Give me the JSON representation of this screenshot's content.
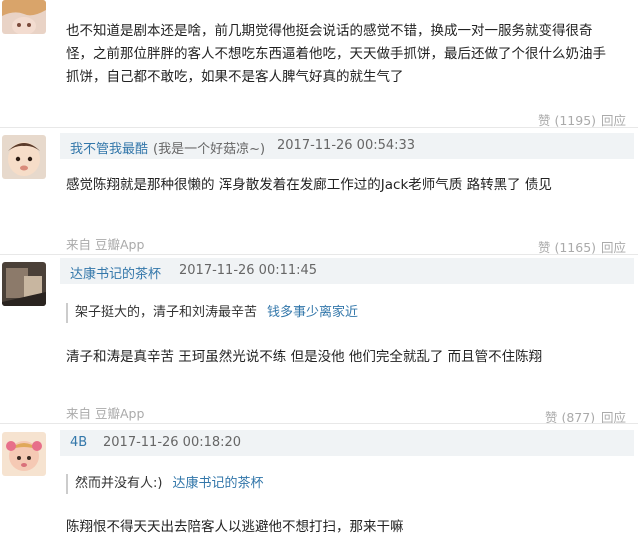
{
  "comment0": {
    "lines": [
      "也不知道是剧本还是啥，前几期觉得他挺会说话的感觉不错，换成一对一服务就变得很奇",
      "怪，之前那位胖胖的客人不想吃东西逼着他吃，天天做手抓饼，最后还做了个很什么奶油手",
      "抓饼，自己都不敢吃，如果不是客人脾气好真的就生气了"
    ],
    "vote": "赞 (1195)",
    "reply": "回应"
  },
  "comment1": {
    "username": "我不管我最酷",
    "note": "(我是一个好菇凉~)",
    "time": "2017-11-26 00:54:33",
    "text": "感觉陈翔就是那种很懒的 浑身散发着在发廊工作过的Jack老师气质 路转黑了 债见",
    "source": "来自 豆瓣App",
    "vote": "赞 (1165)",
    "reply": "回应"
  },
  "comment2": {
    "username": "达康书记的茶杯",
    "time": "2017-11-26 00:11:45",
    "quote_text": "架子挺大的，清子和刘涛最辛苦",
    "quote_author": "钱多事少离家近",
    "text": "清子和涛是真辛苦 王珂虽然光说不练 但是没他 他们完全就乱了 而且管不住陈翔",
    "source": "来自 豆瓣App",
    "vote": "赞 (877)",
    "reply": "回应"
  },
  "comment3": {
    "username": "4B",
    "time": "2017-11-26 00:18:20",
    "quote_text": "然而并没有人:)",
    "quote_author": "达康书记的茶杯",
    "text": "陈翔恨不得天天出去陪客人以逃避他不想打扫，那来干嘛"
  }
}
